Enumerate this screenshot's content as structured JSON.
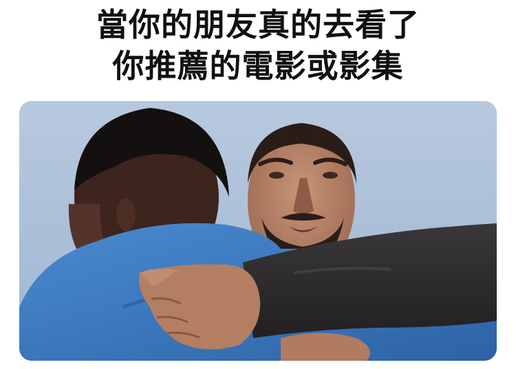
{
  "caption": {
    "line1": "當你的朋友真的去看了",
    "line2": "你推薦的電影或影集"
  },
  "colors": {
    "sky": "#a9bfd8",
    "blue_shirt": "#3f7fc4",
    "dark_sleeve": "#2e2c2e",
    "skin_dark": "#4a2c22",
    "skin_light": "#b9856b",
    "text": "#111111"
  }
}
